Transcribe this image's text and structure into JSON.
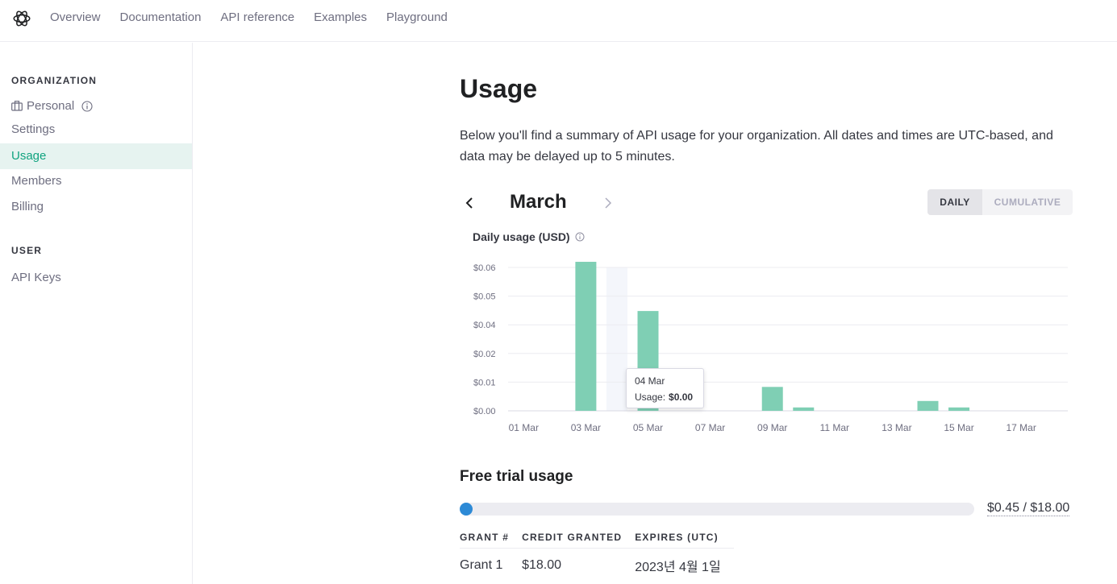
{
  "topnav": {
    "links": [
      "Overview",
      "Documentation",
      "API reference",
      "Examples",
      "Playground"
    ]
  },
  "sidebar": {
    "organization_label": "ORGANIZATION",
    "org_name": "Personal",
    "items": [
      "Settings",
      "Usage",
      "Members",
      "Billing"
    ],
    "active_item": "Usage",
    "user_label": "USER",
    "user_items": [
      "API Keys"
    ]
  },
  "main": {
    "title": "Usage",
    "intro": "Below you'll find a summary of API usage for your organization. All dates and times are UTC-based, and data may be delayed up to 5 minutes.",
    "month": "March",
    "toggle": {
      "daily": "DAILY",
      "cumulative": "CUMULATIVE",
      "selected": "DAILY"
    },
    "chart_title": "Daily usage (USD)",
    "tooltip": {
      "date": "04 Mar",
      "label": "Usage:",
      "value": "$0.00"
    },
    "free_trial": {
      "title": "Free trial usage",
      "used": 0.45,
      "total": 18.0,
      "text": "$0.45 / $18.00"
    },
    "grants": {
      "headers": [
        "GRANT #",
        "CREDIT GRANTED",
        "EXPIRES (UTC)"
      ],
      "rows": [
        [
          "Grant 1",
          "$18.00",
          "2023년 4월 1일"
        ]
      ]
    }
  },
  "colors": {
    "accent": "#10a37f",
    "bar": "#7fcfb4",
    "progress": "#2d8ad6",
    "hover_band": "#f4f6fb"
  },
  "chart_data": {
    "type": "bar",
    "title": "Daily usage (USD)",
    "categories": [
      "01 Mar",
      "02 Mar",
      "03 Mar",
      "04 Mar",
      "05 Mar",
      "06 Mar",
      "07 Mar",
      "08 Mar",
      "09 Mar",
      "10 Mar",
      "11 Mar",
      "12 Mar",
      "13 Mar",
      "14 Mar",
      "15 Mar",
      "16 Mar",
      "17 Mar",
      "18 Mar"
    ],
    "values": [
      0,
      0,
      0.053,
      0,
      0.0355,
      0,
      0,
      0,
      0.0085,
      0.0012,
      0,
      0,
      0,
      0.0035,
      0.0012,
      0,
      0,
      0
    ],
    "tick_labels_x": [
      "01 Mar",
      "03 Mar",
      "05 Mar",
      "07 Mar",
      "09 Mar",
      "11 Mar",
      "13 Mar",
      "15 Mar",
      "17 Mar"
    ],
    "y_ticks": [
      0,
      0.01,
      0.02,
      0.03,
      0.04,
      0.05
    ],
    "y_tick_labels": [
      "$0.00",
      "$0.01",
      "$0.02",
      "$0.04",
      "$0.05",
      "$0.06"
    ],
    "ylim": [
      0,
      0.05
    ],
    "hover_category": "04 Mar",
    "grid": true,
    "xlabel": "",
    "ylabel": ""
  }
}
